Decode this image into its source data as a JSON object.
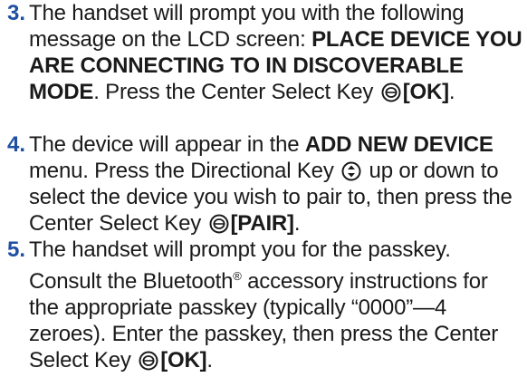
{
  "colors": {
    "step_number": "#1f4fa3",
    "text": "#1a1a1a"
  },
  "steps": [
    {
      "number": "3.",
      "t1": "The handset will prompt you with the following message on the LCD screen: ",
      "b1": "PLACE DEVICE YOU ARE CONNECTING TO IN DISCOVERABLE MODE",
      "t2": ". Press the Center Select Key ",
      "icon": "center-select-key-icon",
      "b2": "[OK]",
      "t3": "."
    },
    {
      "number": "4.",
      "t1": "The device will appear in the ",
      "b1": "ADD NEW DEVICE",
      "t2": " menu. Press the Directional Key ",
      "icon": "directional-key-icon",
      "t3": " up or down to select the device you wish to pair to, then press the Center Select Key ",
      "icon2": "center-select-key-icon",
      "b2": "[PAIR]",
      "t4": "."
    },
    {
      "number": "5.",
      "t1": "The handset will prompt you for the passkey. Consult the Bluetooth",
      "sup": "®",
      "t2": " accessory instructions for the appropriate passkey (typically “0000”—4 zeroes). Enter the passkey, then press the Center Select Key ",
      "icon": "center-select-key-icon",
      "b2": "[OK]",
      "t3": "."
    }
  ]
}
